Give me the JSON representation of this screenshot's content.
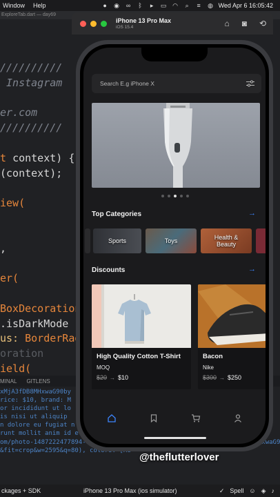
{
  "menubar": {
    "items": [
      "Window",
      "Help"
    ],
    "clock": "Wed Apr 6  16:05:42"
  },
  "editor": {
    "tab": "ExploreTab.dart — day69",
    "code_lines": [
      [
        {
          "t": "//////////",
          "c": "c-comment"
        }
      ],
      [
        {
          "t": " Instagram",
          "c": "c-comment"
        }
      ],
      [
        {
          "t": "",
          "c": "c-white"
        }
      ],
      [
        {
          "t": "er.com",
          "c": "c-comment"
        }
      ],
      [
        {
          "t": "//////////",
          "c": "c-comment"
        }
      ],
      [
        {
          "t": "",
          "c": "c-white"
        }
      ],
      [
        {
          "t": "t ",
          "c": "c-orange"
        },
        {
          "t": "context) {",
          "c": "c-white"
        }
      ],
      [
        {
          "t": "(context);",
          "c": "c-white"
        }
      ],
      [
        {
          "t": "",
          "c": "c-white"
        }
      ],
      [
        {
          "t": "iew(",
          "c": "c-orange"
        }
      ],
      [
        {
          "t": "",
          "c": "c-white"
        }
      ],
      [
        {
          "t": "",
          "c": "c-white"
        }
      ],
      [
        {
          "t": ",",
          "c": "c-white"
        }
      ],
      [
        {
          "t": "",
          "c": "c-white"
        }
      ],
      [
        {
          "t": "er(",
          "c": "c-orange"
        }
      ],
      [
        {
          "t": "",
          "c": "c-white"
        }
      ],
      [
        {
          "t": "BoxDecoration",
          "c": "c-orange"
        }
      ],
      [
        {
          "t": ".isDarkMode ",
          "c": "c-white"
        }
      ],
      [
        {
          "t": "us: ",
          "c": "c-yellow"
        },
        {
          "t": "BorderRad",
          "c": "c-orange"
        }
      ],
      [
        {
          "t": "oration",
          "c": "c-muted"
        }
      ],
      [
        {
          "t": "ield(",
          "c": "c-orange"
        }
      ]
    ],
    "panel_tabs": [
      "MINAL",
      "GITLENS"
    ],
    "terminal_lines": [
      "xMjA3fDB8MHxwaG90by",
      "rice: $10, brand: M",
      "or incididunt ut lo",
      "is nisi ut aliquip",
      "n dolore eu fugiat n",
      "runt mollit anim id e",
      "om/photo-1487222477894-8943e31ef7b2?ixlib=rb-1.2.1&ixid=MnwxMjA3fDB8MHxwaG90by1wYWdlfHx8fGVufDB8fHx8",
      "&fit=crop&w=2595&q=80), colors: [Re                                         [S, M, L]"
    ],
    "status_left": "ckages + SDK",
    "status_center": "iPhone 13 Pro Max (ios simulator)",
    "status_spell": "Spell"
  },
  "simulator": {
    "device_name": "iPhone 13 Pro Max",
    "ios_version": "iOS 15.4"
  },
  "app": {
    "search_placeholder": "Search E.g iPhone X",
    "carousel_count": 5,
    "carousel_active": 3,
    "top_categories_title": "Top Categories",
    "discounts_title": "Discounts",
    "categories": [
      {
        "label": "",
        "bg": "#2a2a2c"
      },
      {
        "label": "Sports",
        "bg": "#3b3d42"
      },
      {
        "label": "Toys",
        "bg": "#6d5a4a"
      },
      {
        "label": "Health & Beauty",
        "bg": "#a0532e"
      },
      {
        "label": "",
        "bg": "#7a2a35"
      }
    ],
    "products": [
      {
        "title": "High Quality Cotton T-Shirt",
        "brand": "MOQ",
        "old_price": "$20",
        "new_price": "$10"
      },
      {
        "title": "Bacon",
        "brand": "Nike",
        "old_price": "$300",
        "new_price": "$250"
      }
    ],
    "accent": "#3d86ff"
  },
  "watermark": "@theflutterlover"
}
